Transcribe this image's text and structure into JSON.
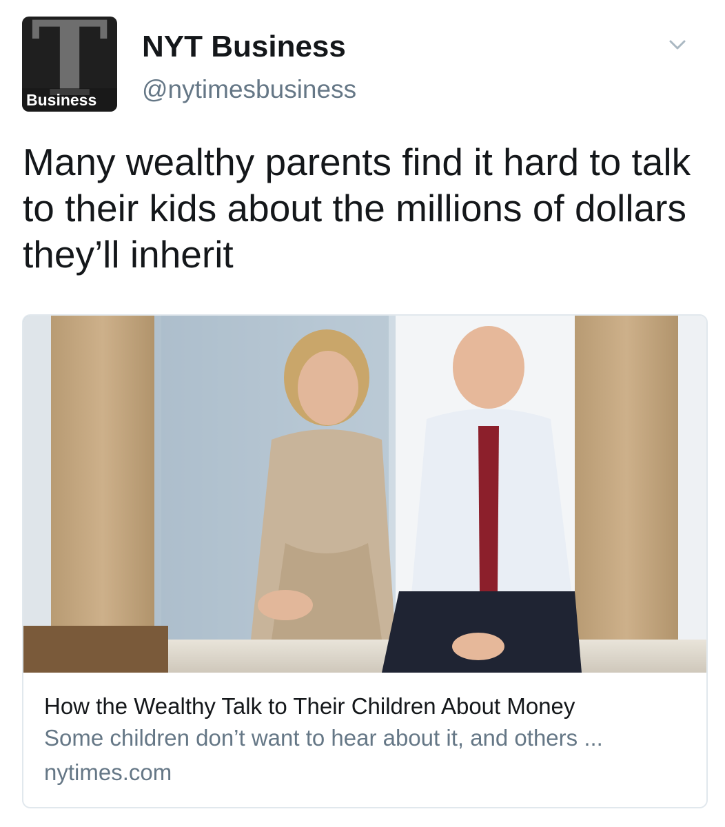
{
  "account": {
    "name": "NYT Business",
    "handle": "@nytimesbusiness",
    "avatar_label": "Business",
    "avatar_glyph": "T"
  },
  "tweet": {
    "text": "Many wealthy parents find it hard to talk to their kids about the millions of dollars they’ll inherit"
  },
  "card": {
    "image_icon": "photo-couple-seated-by-window",
    "title": "How the Wealthy Talk to Their Children About Money",
    "description": "Some children don’t want to hear about it, and others ...",
    "domain": "nytimes.com"
  },
  "colors": {
    "text_primary": "#14171a",
    "text_secondary": "#657786",
    "card_border": "#e1e8ed",
    "avatar_bg": "#1f1f1f"
  }
}
